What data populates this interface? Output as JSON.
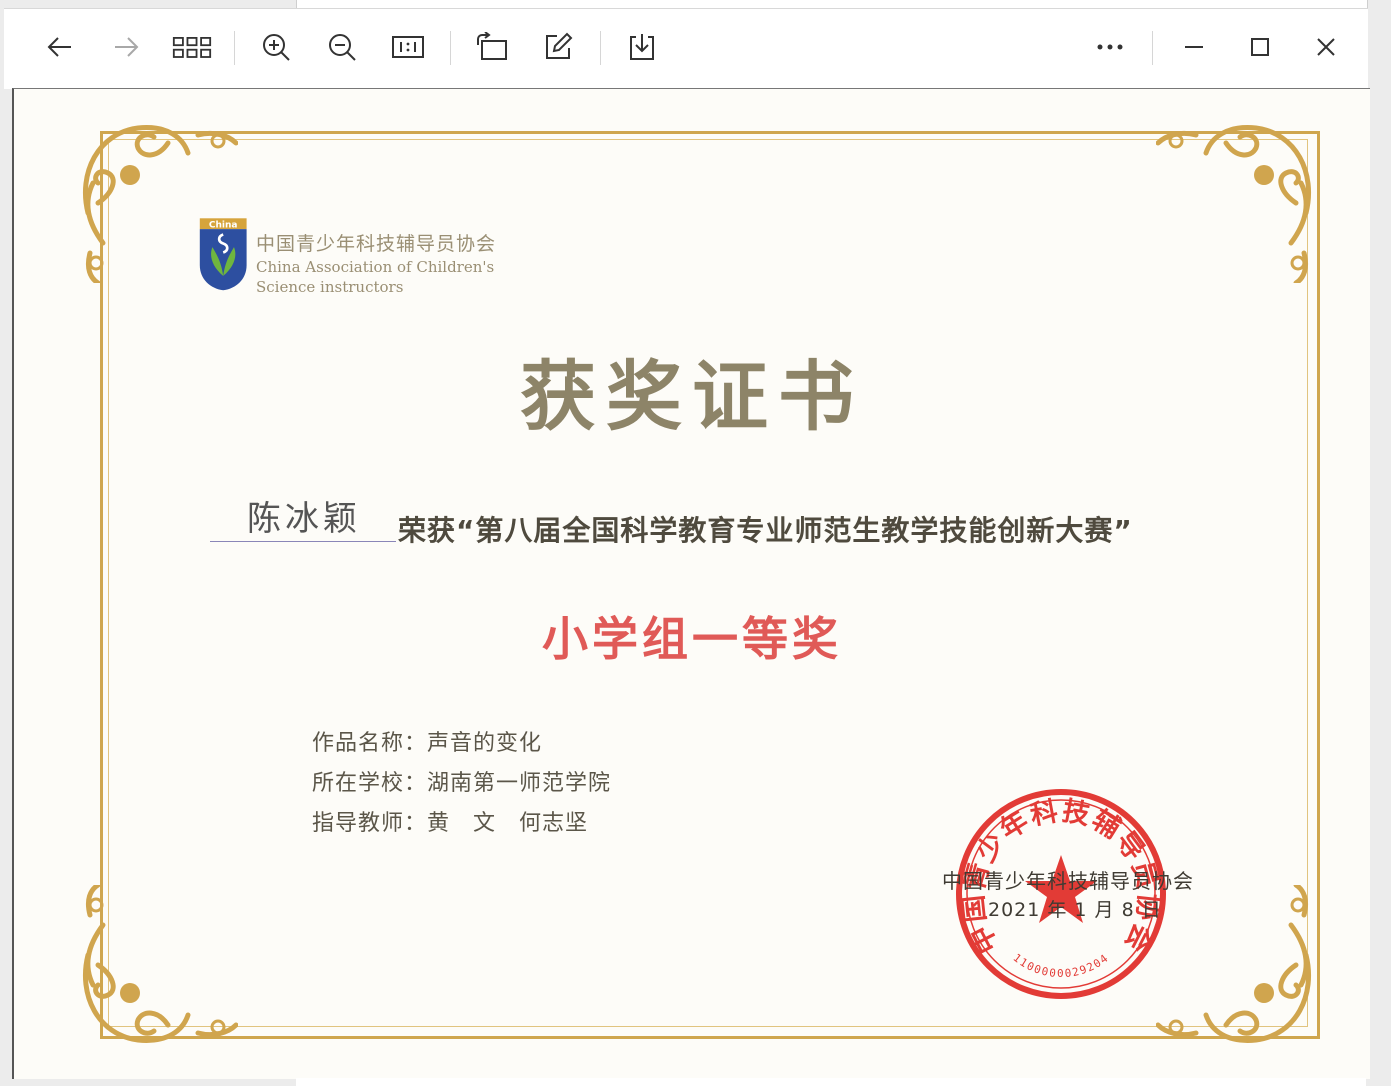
{
  "toolbar": {
    "icons": [
      "back-arrow-icon",
      "forward-arrow-icon",
      "grid-view-icon",
      "zoom-in-icon",
      "zoom-out-icon",
      "actual-size-icon",
      "rotate-icon",
      "edit-icon",
      "download-icon",
      "more-icon",
      "minimize-icon",
      "maximize-icon",
      "close-icon"
    ]
  },
  "certificate": {
    "org_cn": "中国青少年科技辅导员协会",
    "org_en_line1": "China Association of Children's",
    "org_en_line2": "Science instructors",
    "logo_badge": "China",
    "title": "获奖证书",
    "recipient": "陈冰颖",
    "award_text": "荣获“第八届全国科学教育专业师范生教学技能创新大赛”",
    "level": "小学组一等奖",
    "work_label": "作品名称：",
    "work_value": "声音的变化",
    "school_label": "所在学校：",
    "school_value": "湖南第一师范学院",
    "mentor_label": "指导教师：",
    "mentor_value": "黄　文　何志坚",
    "issuer": "中国青少年科技辅导员协会",
    "date": "2021 年 1 月 8 日",
    "seal_text": "中国青少年科技辅导员协会",
    "seal_number": "1100000029204"
  },
  "colors": {
    "gold": "#cfa64e",
    "title": "#8d8468",
    "level": "#e05a57",
    "seal": "#e23b36"
  }
}
